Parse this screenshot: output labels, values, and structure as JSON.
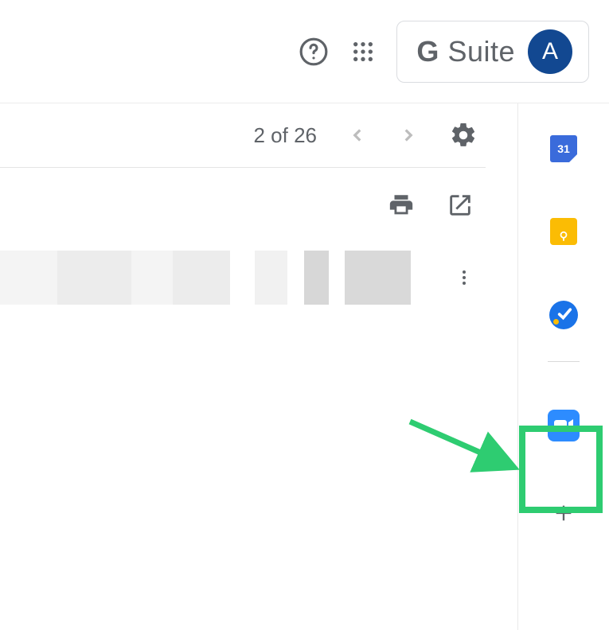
{
  "header": {
    "help_icon": "help-icon",
    "apps_icon": "apps-grid-icon",
    "gsuite_label_g": "G",
    "gsuite_label_rest": " Suite",
    "avatar_initial": "A"
  },
  "toolbar": {
    "pager_text": "2 of 26",
    "prev_icon": "chevron-left-icon",
    "next_icon": "chevron-right-icon",
    "settings_icon": "gear-icon"
  },
  "actions": {
    "print_icon": "print-icon",
    "open_external_icon": "open-in-new-icon",
    "more_icon": "kebab-icon"
  },
  "side_panel": {
    "calendar_label": "31",
    "calendar_name": "calendar-icon",
    "keep_name": "keep-icon",
    "tasks_name": "tasks-icon",
    "zoom_name": "zoom-icon",
    "add_name": "plus-icon"
  }
}
